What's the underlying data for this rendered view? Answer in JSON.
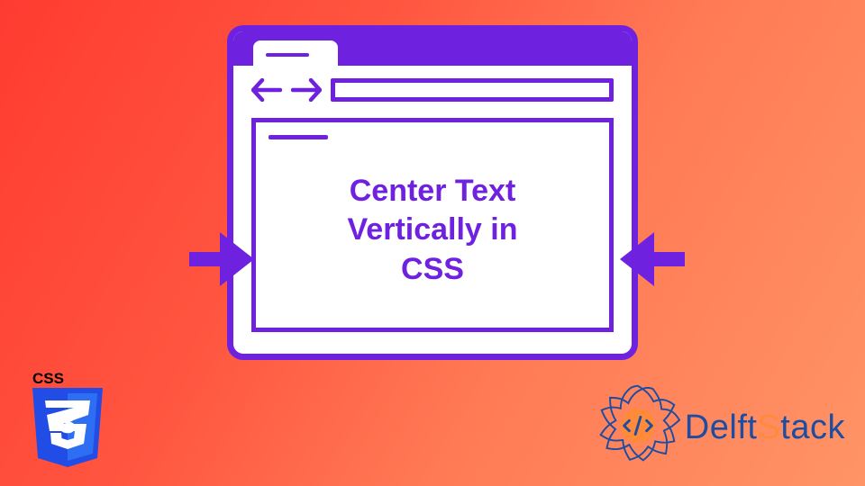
{
  "main_text": "Center Text Vertically in CSS",
  "css_badge": {
    "label": "CSS",
    "glyph": "3"
  },
  "brand": {
    "prefix": "Delft",
    "suffix": "tack"
  },
  "icons": {
    "back": "back-arrow-icon",
    "forward": "forward-arrow-icon",
    "big_arrow_right": "big-arrow-right-icon",
    "big_arrow_left": "big-arrow-left-icon",
    "delft_logo": "delftstack-logo-icon",
    "css_badge": "css3-badge-icon"
  },
  "colors": {
    "accent": "#6f21e0",
    "brand_blue": "#1d4da3",
    "brand_orange": "#ff8a3a"
  }
}
